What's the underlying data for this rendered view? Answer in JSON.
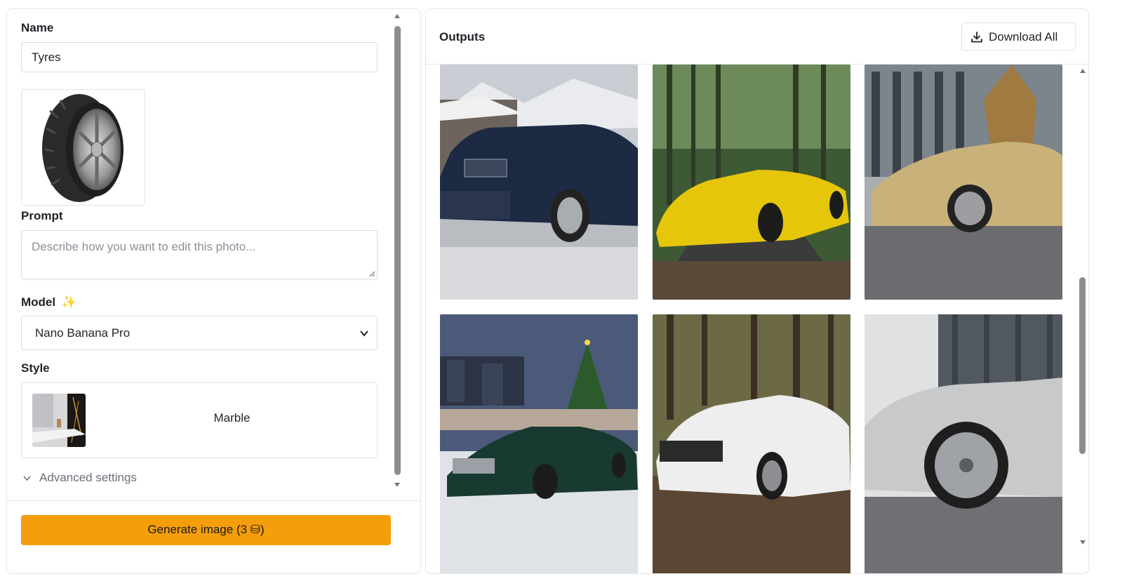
{
  "form": {
    "name_label": "Name",
    "name_value": "Tyres",
    "prompt_label": "Prompt",
    "prompt_placeholder": "Describe how you want to edit this photo...",
    "model_label": "Model",
    "model_sparkle": "✨",
    "model_value": "Nano Banana Pro",
    "style_label": "Style",
    "style_value": "Marble",
    "advanced_label": "Advanced settings",
    "generate_label": "Generate image (3 ⛁)"
  },
  "outputs": {
    "title": "Outputs",
    "download_all_label": "Download All",
    "images": [
      {
        "name": "dark-blue-suv-snow",
        "car_color": "#1d2a44"
      },
      {
        "name": "yellow-sports-car-forest",
        "car_color": "#e6c60a"
      },
      {
        "name": "gold-sedan-city",
        "car_color": "#c8b27a"
      },
      {
        "name": "green-coupe-christmas",
        "car_color": "#183a30"
      },
      {
        "name": "white-suv-forest",
        "car_color": "#eeeeee"
      },
      {
        "name": "silver-sedan-closeup",
        "car_color": "#c8c9cb"
      }
    ]
  },
  "colors": {
    "accent": "#f59e0b",
    "border": "#e6e6e6",
    "scrollbar": "#8d8d8d"
  }
}
